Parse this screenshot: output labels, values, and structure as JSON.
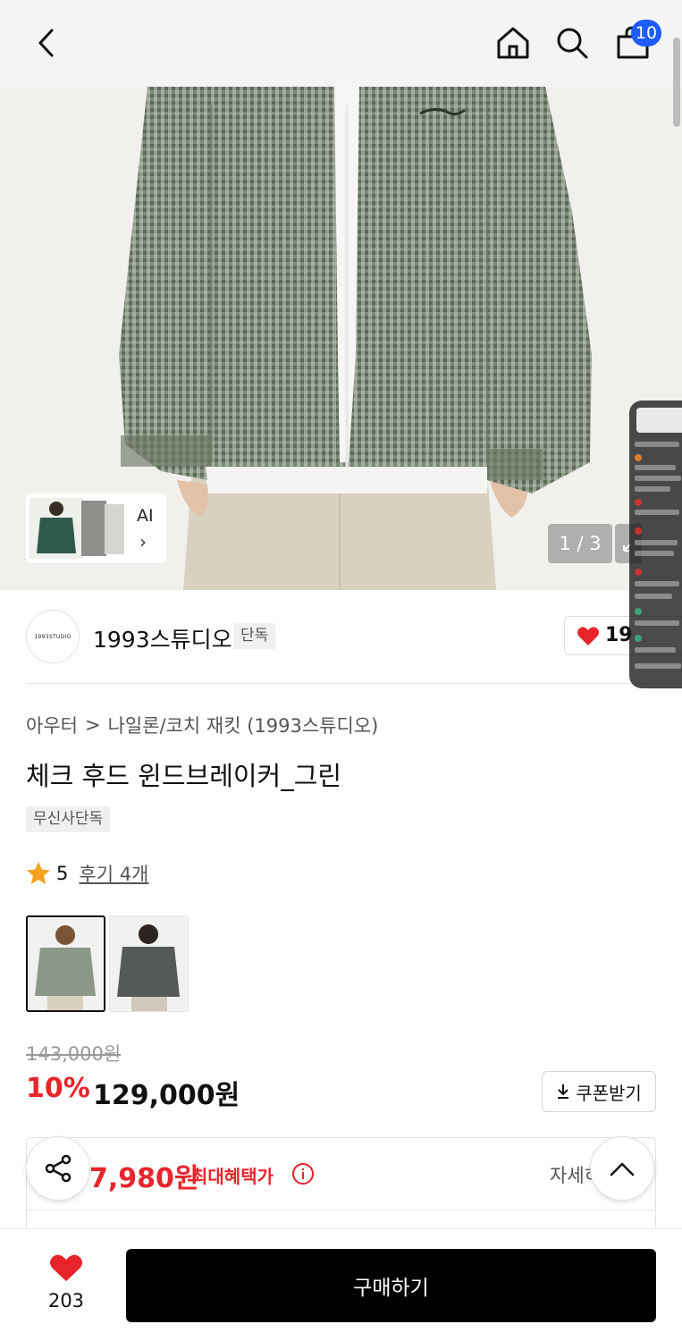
{
  "header": {
    "back_icon": "chevron-left-icon",
    "home_icon": "home-icon",
    "search_icon": "search-icon",
    "bag_icon": "shopping-bag-icon",
    "bag_count": "10",
    "badge_color": "#1f5cff"
  },
  "gallery": {
    "ai_label": "AI",
    "ai_chevron": "›",
    "counter": "1 / 3"
  },
  "brand": {
    "logo_text": "1993STUDIO",
    "name": "1993스튜디오",
    "tag": "단독",
    "like_count": "19"
  },
  "product": {
    "breadcrumb_category": "아우터",
    "breadcrumb_separator": ">",
    "breadcrumb_subcategory": "나일론/코치 재킷 (1993스튜디오)",
    "title": "체크 후드 윈드브레이커_그린",
    "exclusive_tag": "무신사단독",
    "rating_score": "5",
    "review_link": "후기 4개",
    "original_price": "143,000원",
    "discount": "10%",
    "sale_price": "129,000원",
    "coupon_label": "쿠폰받기",
    "benefit_price": "7,980원",
    "benefit_label": "최대혜택가",
    "benefit_detail": "자세히"
  },
  "bottom_bar": {
    "wish_count": "203",
    "buy_label": "구매하기"
  },
  "colors": {
    "accent_red": "#e8242b",
    "buy_button": "#000000"
  }
}
